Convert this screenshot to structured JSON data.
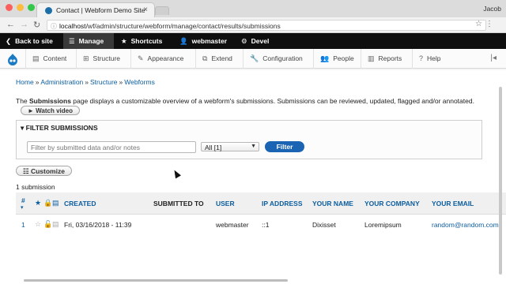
{
  "browser": {
    "tab_title": "Contact | Webform Demo Site",
    "profile_name": "Jacob",
    "url_host": "localhost",
    "url_path": "/wf/admin/structure/webform/manage/contact/results/submissions",
    "traffic_colors": [
      "#fc605c",
      "#fdbc40",
      "#34c84a"
    ]
  },
  "toolbar": {
    "back_to_site": "Back to site",
    "manage": "Manage",
    "shortcuts": "Shortcuts",
    "user": "webmaster",
    "devel": "Devel"
  },
  "menu": {
    "items": [
      "Content",
      "Structure",
      "Appearance",
      "Extend",
      "Configuration",
      "People",
      "Reports",
      "Help"
    ]
  },
  "breadcrumb": [
    "Home",
    "Administration",
    "Structure",
    "Webforms"
  ],
  "description": {
    "text_before": "The ",
    "text_bold": "Submissions",
    "text_after": " page displays a customizable overview of a webform's submissions. Submissions can be reviewed, updated, flagged and/or annotated.",
    "watch_video": "► Watch video"
  },
  "filter": {
    "label": "▾ FILTER SUBMISSIONS",
    "placeholder": "Filter by submitted data and/or notes",
    "state_select": "All [1]",
    "button": "Filter"
  },
  "customize_button": "☷ Customize",
  "submission_count": "1 submission",
  "table": {
    "headers": {
      "sid": "#",
      "created": "CREATED",
      "submitted_to": "SUBMITTED TO",
      "user": "USER",
      "ip": "IP ADDRESS",
      "name": "YOUR NAME",
      "company": "YOUR COMPANY",
      "email": "YOUR EMAIL"
    },
    "rows": [
      {
        "sid": "1",
        "created": "Fri, 03/16/2018 - 11:39",
        "submitted_to": "",
        "user": "webmaster",
        "ip": "::1",
        "name": "Dixisset",
        "company": "Loremipsum",
        "email": "random@random.com"
      }
    ]
  },
  "colors": {
    "link": "#0b5d9f",
    "filter_button": "#1a64b3",
    "toolbar_bg": "#0f0f0f"
  }
}
